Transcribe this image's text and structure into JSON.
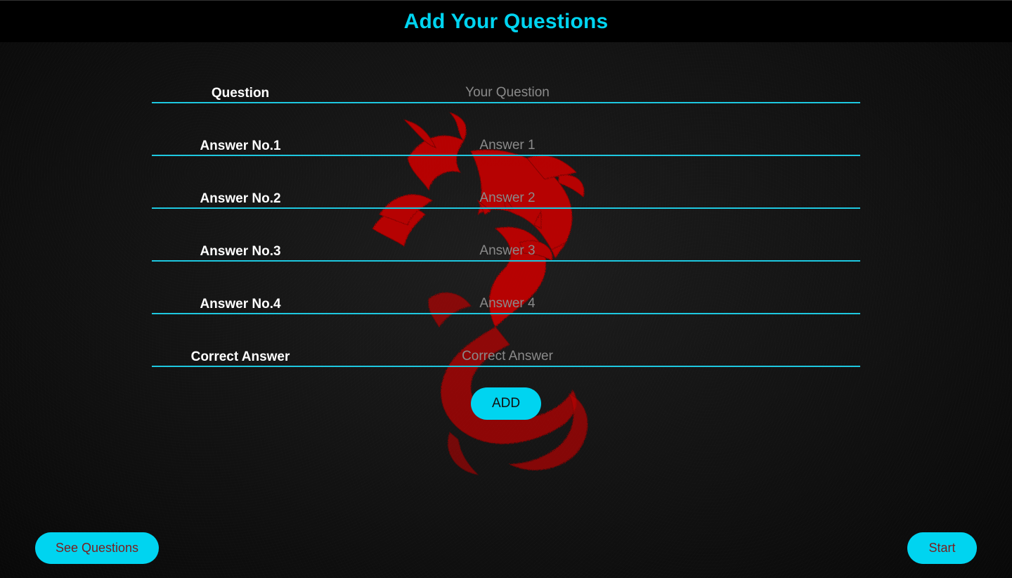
{
  "header": {
    "title": "Add Your Questions"
  },
  "form": {
    "fields": [
      {
        "label": "Question",
        "placeholder": "Your Question",
        "value": ""
      },
      {
        "label": "Answer No.1",
        "placeholder": "Answer 1",
        "value": ""
      },
      {
        "label": "Answer No.2",
        "placeholder": "Answer 2",
        "value": ""
      },
      {
        "label": "Answer No.3",
        "placeholder": "Answer 3",
        "value": ""
      },
      {
        "label": "Answer No.4",
        "placeholder": "Answer 4",
        "value": ""
      },
      {
        "label": "Correct Answer",
        "placeholder": "Correct Answer",
        "value": ""
      }
    ],
    "add_label": "ADD"
  },
  "footer": {
    "see_questions_label": "See Questions",
    "start_label": "Start"
  },
  "colors": {
    "accent": "#00d4f0",
    "underline": "#1ec8e0",
    "dragon": "#d40000",
    "button_text": "#7a1f1f"
  },
  "icons": {
    "background": "dragon-icon"
  }
}
